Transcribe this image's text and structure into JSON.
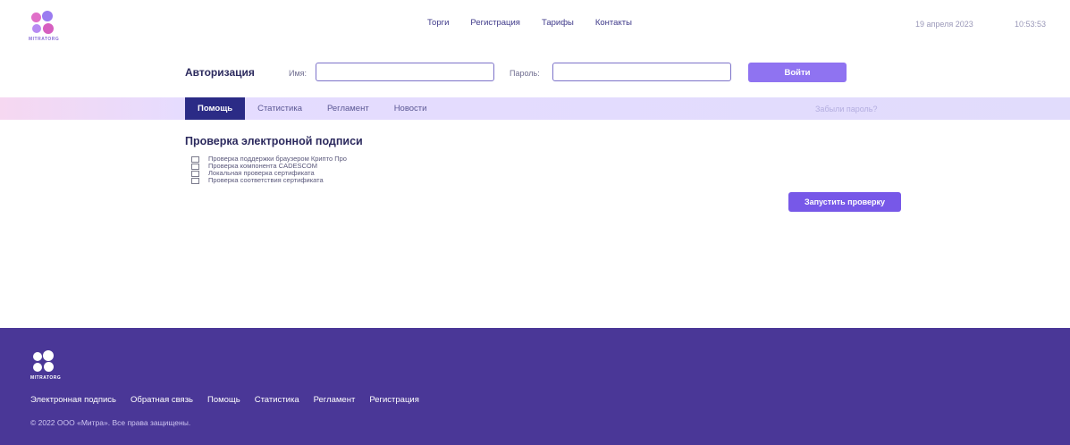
{
  "header": {
    "logo_text": "MITRATORG",
    "nav": [
      "Торги",
      "Регистрация",
      "Тарифы",
      "Контакты"
    ],
    "date": "19 апреля 2023",
    "time": "10:53:53"
  },
  "auth": {
    "title": "Авторизация",
    "name_label": "Имя:",
    "name_value": "",
    "password_label": "Пароль:",
    "password_value": "",
    "login_button": "Войти"
  },
  "menu": {
    "tabs": [
      "Помощь",
      "Статистика",
      "Регламент",
      "Новости"
    ],
    "active_tab": "Помощь",
    "forgot_password": "Забыли пароль?"
  },
  "check": {
    "title": "Проверка электронной подписи",
    "items": [
      {
        "label": "Проверка поддержки браузером Крипто Про",
        "checked": false
      },
      {
        "label": "Проверка компонента CADESCOM",
        "checked": false
      },
      {
        "label": "Локальная проверка сертификата",
        "checked": false
      },
      {
        "label": "Проверка соответствия сертификата",
        "checked": false
      }
    ],
    "run_button": "Запустить проверку"
  },
  "footer": {
    "logo_text": "MITRATORG",
    "links": [
      "Электронная подпись",
      "Обратная связь",
      "Помощь",
      "Статистика",
      "Регламент",
      "Регистрация"
    ],
    "copyright": "© 2022 ООО «Митра». Все права защищены."
  },
  "colors": {
    "accent": "#8f73f1",
    "active_tab": "#2b2b86",
    "footer_bg": "#4a3797",
    "input_border": "#7d73c9"
  }
}
